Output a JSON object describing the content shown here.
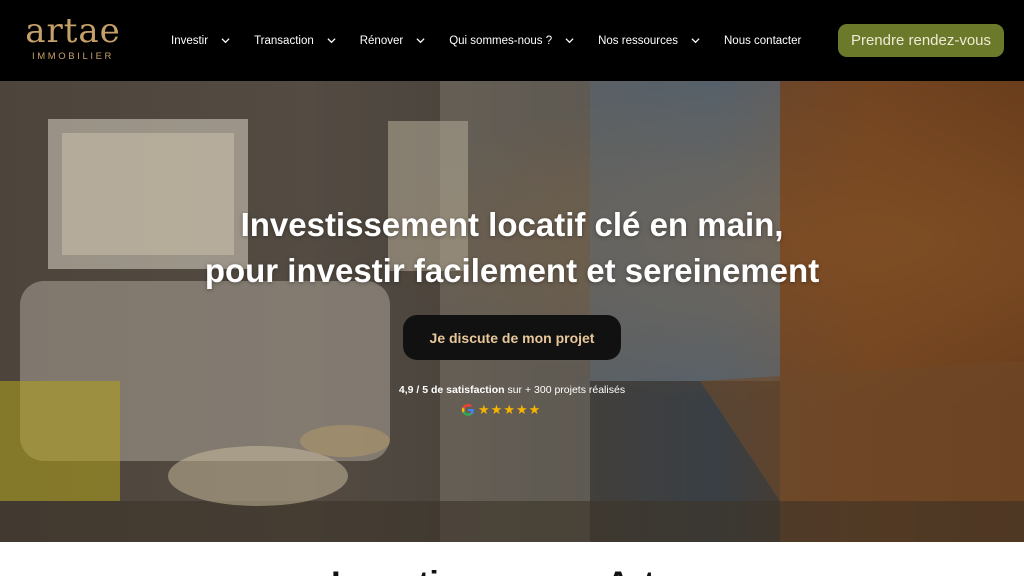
{
  "brand": {
    "name": "artae",
    "subtitle": "IMMOBILIER",
    "gold": "#c6a06a"
  },
  "nav": {
    "items": [
      {
        "label": "Investir",
        "has_dropdown": true
      },
      {
        "label": "Transaction",
        "has_dropdown": true
      },
      {
        "label": "Rénover",
        "has_dropdown": true
      },
      {
        "label": "Qui sommes-nous ?",
        "has_dropdown": true
      },
      {
        "label": "Nos ressources",
        "has_dropdown": true
      },
      {
        "label": "Nous contacter",
        "has_dropdown": false
      }
    ],
    "cta_label": "Prendre rendez-vous",
    "cta_color": "#6b7a2a"
  },
  "hero": {
    "title_line1": "Investissement locatif clé en main,",
    "title_line2": "pour investir facilement et sereinement",
    "button_label": "Je discute de mon projet",
    "rating_strong": "4,9 / 5 de satisfaction",
    "rating_rest": " sur + 300 projets réalisés",
    "stars": 5,
    "star_color": "#f5b400",
    "review_source_icon": "google-icon"
  },
  "section": {
    "partial_title": "Investissez avec Artae"
  }
}
